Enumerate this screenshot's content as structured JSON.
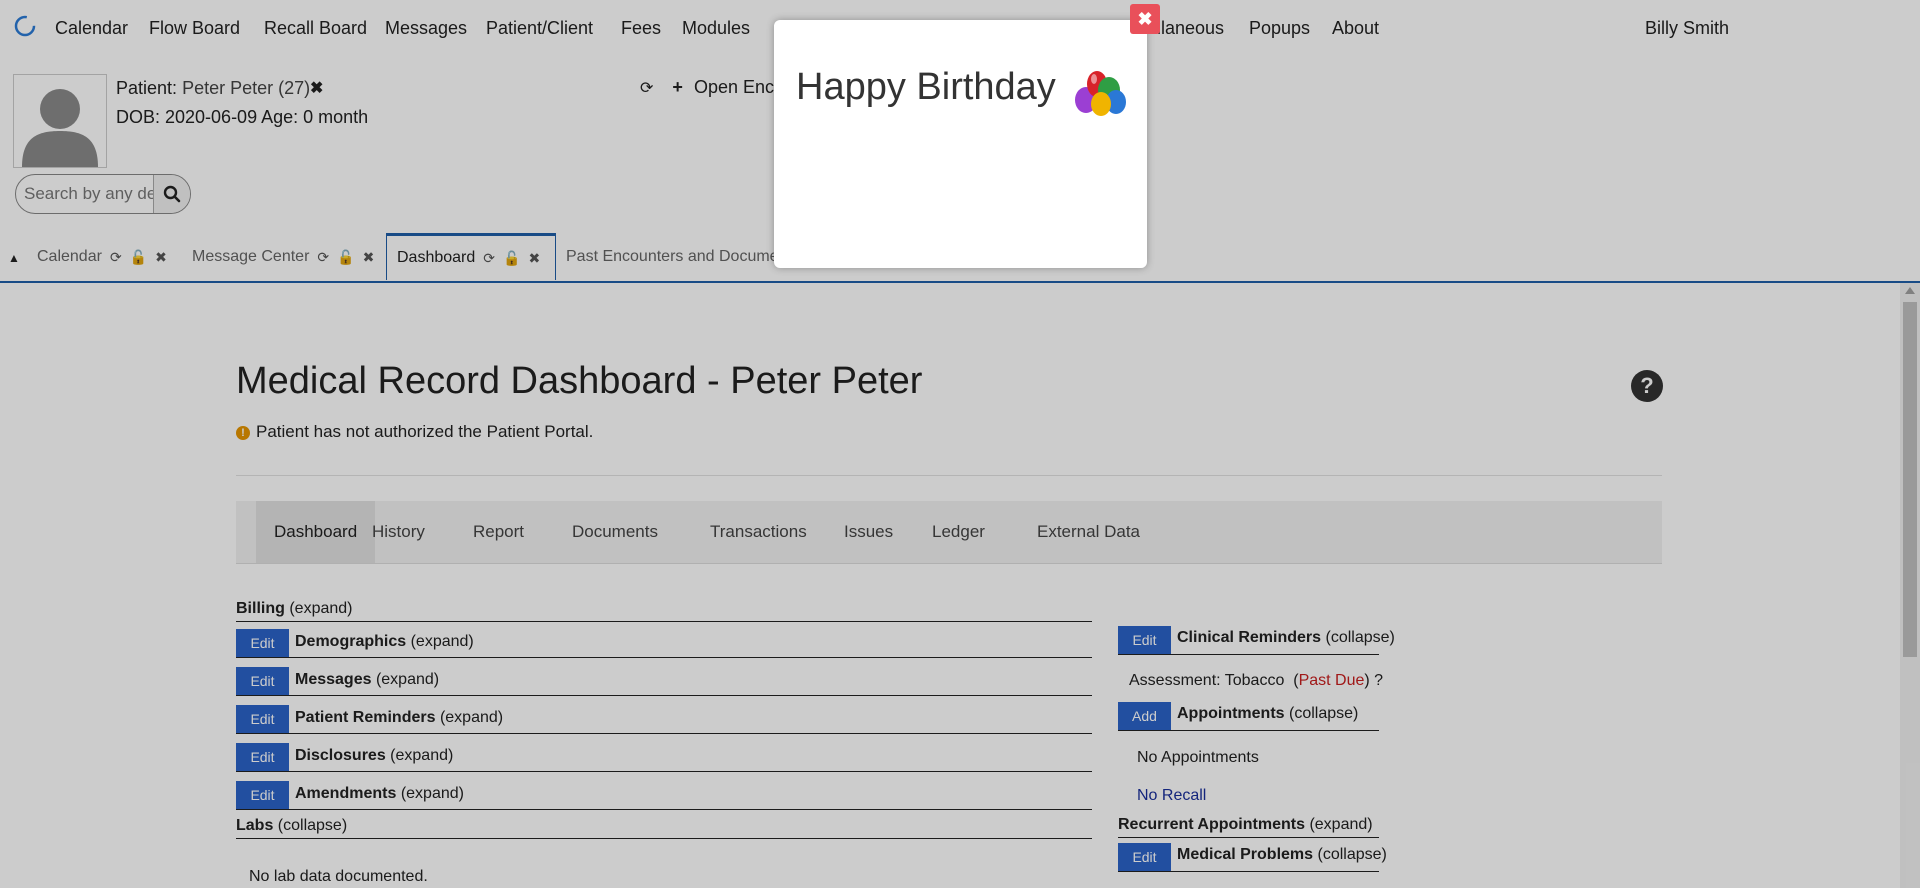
{
  "nav": {
    "items": [
      "Calendar",
      "Flow Board",
      "Recall Board",
      "Messages",
      "Patient/Client",
      "Fees",
      "Modules",
      "llaneous",
      "Popups",
      "About"
    ],
    "user": "Billy Smith"
  },
  "patient": {
    "label": "Patient:",
    "name": "Peter Peter (27)",
    "dob_line": "DOB: 2020-06-09 Age: 0 month",
    "search_placeholder": "Search by any demographic",
    "open_encounter": "Open Enc"
  },
  "tabs": [
    {
      "label": "Calendar"
    },
    {
      "label": "Message Center"
    },
    {
      "label": "Dashboard"
    },
    {
      "label": "Past Encounters and Documen"
    }
  ],
  "main": {
    "title": "Medical Record Dashboard - Peter Peter",
    "portal_note": "Patient has not authorized the Patient Portal.",
    "record_tabs": [
      "Dashboard",
      "History",
      "Report",
      "Documents",
      "Transactions",
      "Issues",
      "Ledger",
      "External Data"
    ]
  },
  "widgets_left": {
    "billing": {
      "title": "Billing",
      "state": "(expand)"
    },
    "rows": [
      {
        "button": "Edit",
        "title": "Demographics",
        "state": "(expand)"
      },
      {
        "button": "Edit",
        "title": "Messages",
        "state": "(expand)"
      },
      {
        "button": "Edit",
        "title": "Patient Reminders",
        "state": "(expand)"
      },
      {
        "button": "Edit",
        "title": "Disclosures",
        "state": "(expand)"
      },
      {
        "button": "Edit",
        "title": "Amendments",
        "state": "(expand)"
      }
    ],
    "labs": {
      "title": "Labs",
      "state": "(collapse)"
    },
    "no_labs": "No lab data documented."
  },
  "widgets_right": {
    "clinical": {
      "button": "Edit",
      "title": "Clinical Reminders",
      "state": "(collapse)"
    },
    "assessment": {
      "text": "Assessment: Tobacco",
      "paren_open": "(",
      "status": "Past Due",
      "paren_close": ")",
      "help": "?"
    },
    "appointments": {
      "button": "Add",
      "title": "Appointments",
      "state": "(collapse)"
    },
    "no_appointments": "No Appointments",
    "no_recall": "No Recall",
    "recurrent": {
      "title": "Recurrent Appointments",
      "state": "(expand)"
    },
    "medical": {
      "button": "Edit",
      "title": "Medical Problems",
      "state": "(collapse)"
    }
  },
  "modal": {
    "title": "Happy Birthday",
    "close": "✖"
  },
  "colors": {
    "accent": "#1f5ea8",
    "button": "#2b63c8",
    "past_due": "#c81e1e",
    "close_red": "#e9505a"
  }
}
